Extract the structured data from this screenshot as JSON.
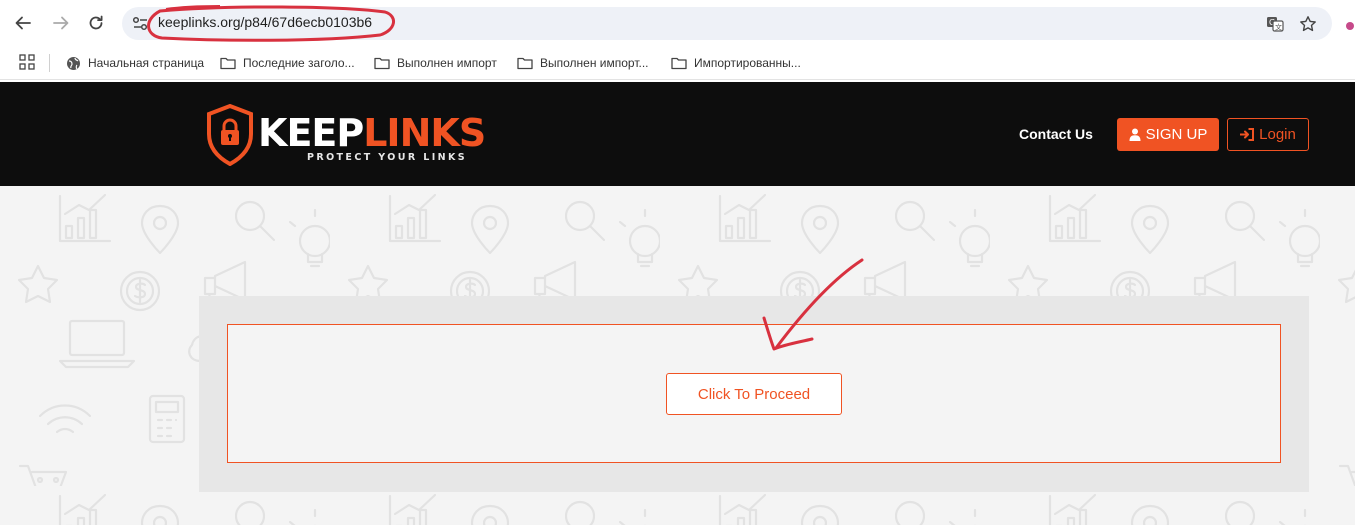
{
  "browser": {
    "url": "keeplinks.org/p84/67d6ecb0103b6",
    "icons": [
      "back-arrow-icon",
      "forward-arrow-icon",
      "reload-icon",
      "site-info-icon",
      "translate-icon",
      "bookmark-star-icon",
      "apps-grid-icon"
    ],
    "bookmarks": [
      {
        "label": "Начальная страница",
        "icon": "globe-icon"
      },
      {
        "label": "Последние заголо...",
        "icon": "folder-icon"
      },
      {
        "label": "Выполнен импорт",
        "icon": "folder-icon"
      },
      {
        "label": "Выполнен импорт...",
        "icon": "folder-icon"
      },
      {
        "label": "Импортированны...",
        "icon": "folder-icon"
      }
    ]
  },
  "site": {
    "logo": {
      "word_white": "KEEP",
      "word_orange": "LINKS",
      "tagline": "PROTECT YOUR LINKS"
    },
    "nav": {
      "contact": "Contact Us",
      "signup": "SIGN UP",
      "login": "Login"
    },
    "colors": {
      "brand": "#f05323",
      "header_bg": "#0d0d0d",
      "content_bg": "#f4f4f4"
    }
  },
  "main": {
    "proceed_label": "Click To Proceed"
  },
  "annotations": {
    "color": "#d8313f",
    "items": [
      "ellipse-around-url",
      "arrow-pointing-to-proceed-box"
    ]
  }
}
